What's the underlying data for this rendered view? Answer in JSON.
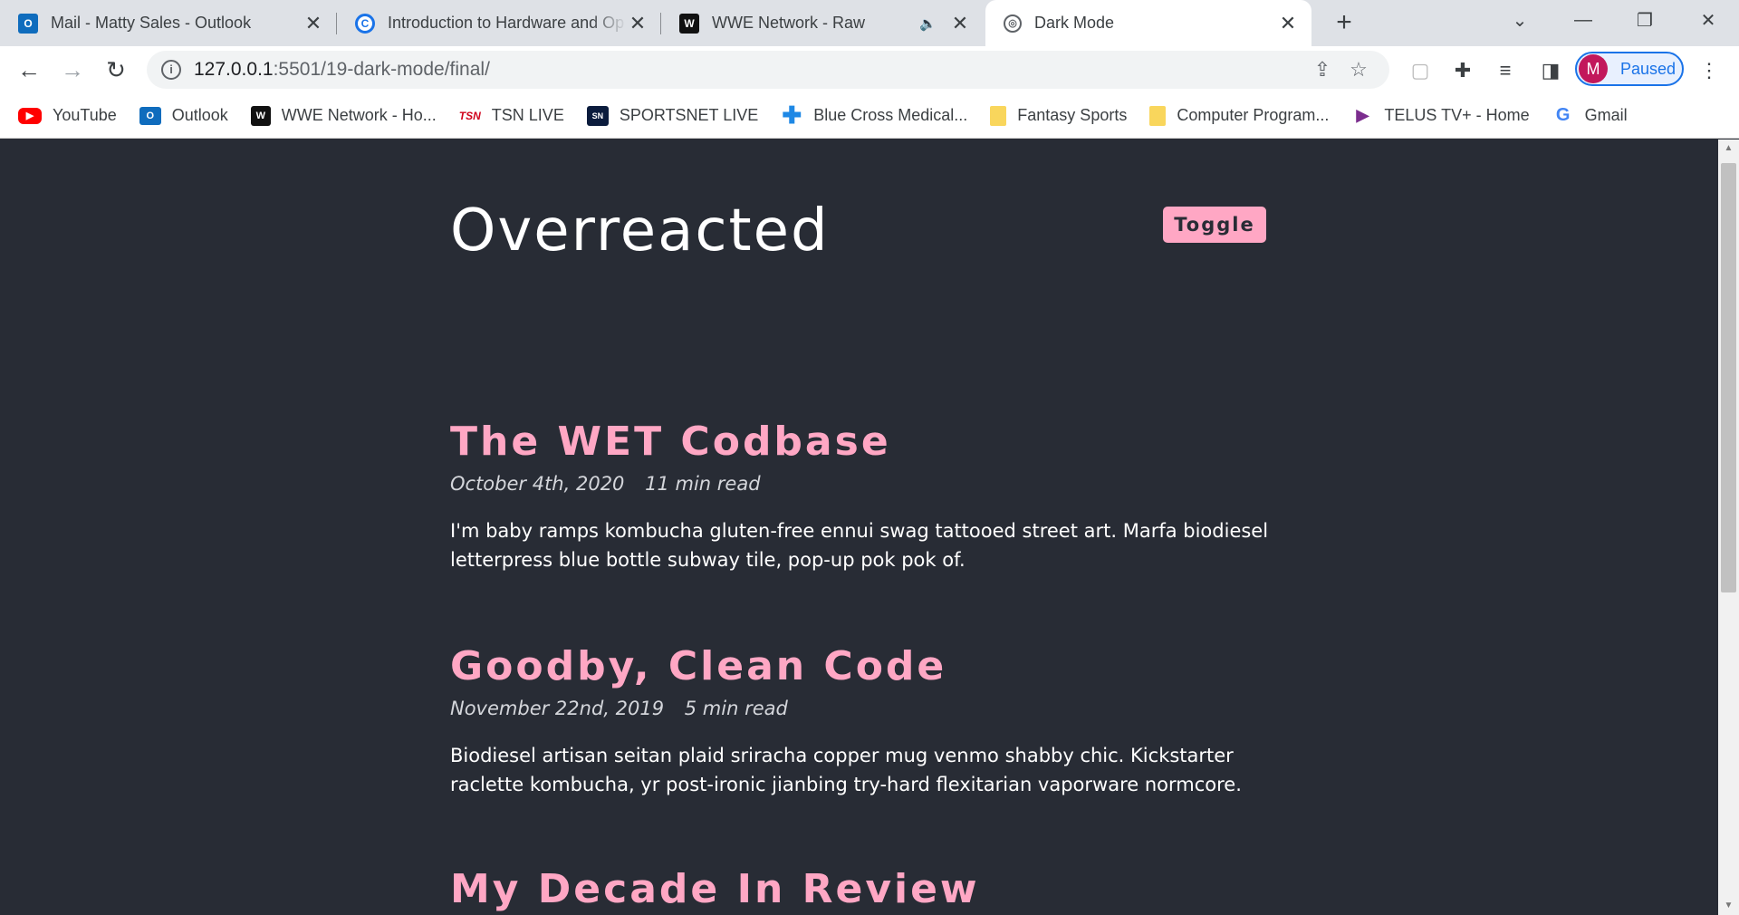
{
  "browser": {
    "tabs": [
      {
        "title": "Mail - Matty Sales - Outlook",
        "icon": "outlook-icon"
      },
      {
        "title": "Introduction to Hardware and Op",
        "icon": "c-icon"
      },
      {
        "title": "WWE Network - Raw",
        "icon": "wwe-icon",
        "audio": true
      },
      {
        "title": "Dark Mode",
        "icon": "globe-icon",
        "active": true
      }
    ],
    "url_host": "127.0.0.1",
    "url_path": ":5501/19-dark-mode/final/",
    "profile_initial": "M",
    "profile_status": "Paused",
    "bookmarks": [
      {
        "label": "YouTube",
        "icon": "youtube-icon"
      },
      {
        "label": "Outlook",
        "icon": "outlook-icon"
      },
      {
        "label": "WWE Network - Ho...",
        "icon": "wwe-icon"
      },
      {
        "label": "TSN LIVE",
        "icon": "tsn-icon"
      },
      {
        "label": "SPORTSNET LIVE",
        "icon": "sportsnet-icon"
      },
      {
        "label": "Blue Cross Medical...",
        "icon": "cross-icon"
      },
      {
        "label": "Fantasy Sports",
        "icon": "folder-icon"
      },
      {
        "label": "Computer Program...",
        "icon": "folder-icon"
      },
      {
        "label": "TELUS TV+ - Home",
        "icon": "play-icon"
      },
      {
        "label": "Gmail",
        "icon": "google-icon"
      }
    ]
  },
  "page": {
    "site_title": "Overreacted",
    "toggle_label": "Toggle",
    "posts": [
      {
        "title": "The WET Codbase",
        "date": "October 4th, 2020",
        "read_time": "11 min read",
        "body": "I'm baby ramps kombucha gluten-free ennui swag tattooed street art. Marfa biodiesel letterpress blue bottle subway tile, pop-up pok pok of."
      },
      {
        "title": "Goodby, Clean Code",
        "date": "November 22nd, 2019",
        "read_time": "5 min read",
        "body": "Biodiesel artisan seitan plaid sriracha copper mug venmo shabby chic. Kickstarter raclette kombucha, yr post-ironic jianbing try-hard flexitarian vaporware normcore."
      },
      {
        "title": "My Decade In Review"
      }
    ]
  },
  "colors": {
    "page_background": "#282c35",
    "accent_pink": "#ffa7c4",
    "text": "#ffffff"
  }
}
